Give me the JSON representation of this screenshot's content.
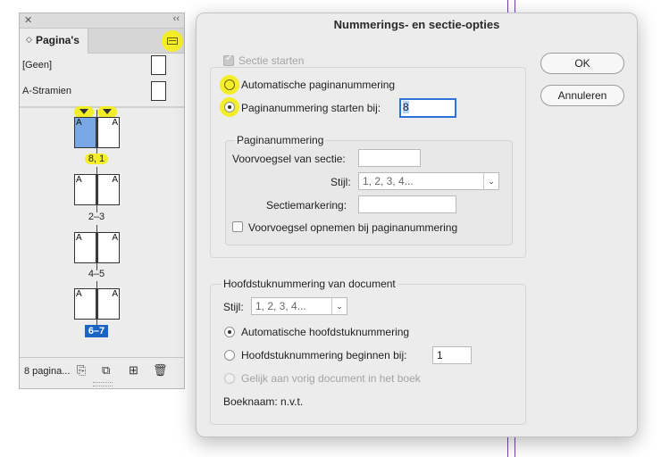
{
  "pages_panel": {
    "close_icon": "close-icon",
    "collapse_icon": "double-chevron-icon",
    "tab_label": "Pagina's",
    "masters": [
      "[Geen]",
      "A-Stramien"
    ],
    "spreads": [
      {
        "label": "8, 1",
        "left_letter": "A",
        "right_letter": "A"
      },
      {
        "label": "2–3",
        "left_letter": "A",
        "right_letter": "A"
      },
      {
        "label": "4–5",
        "left_letter": "A",
        "right_letter": "A"
      },
      {
        "label": "6–7",
        "left_letter": "A",
        "right_letter": "A"
      }
    ],
    "footer_count": "8 pagina...",
    "highlight_color": "#f4ee2a",
    "selection_color": "#1a64c6"
  },
  "dialog": {
    "title": "Nummerings- en sectie-opties",
    "section_start_label": "Sectie starten",
    "auto_numbering_label": "Automatische paginanummering",
    "start_at_label": "Paginanummering starten bij:",
    "start_at_value": "8",
    "page_numbering_group": {
      "title": "Paginanummering",
      "prefix_label": "Voorvoegsel van sectie:",
      "prefix_value": "",
      "style_label": "Stijl:",
      "style_value": "1, 2, 3, 4...",
      "marker_label": "Sectiemarkering:",
      "marker_value": "",
      "include_prefix_label": "Voorvoegsel opnemen bij paginanummering"
    },
    "chapter_group": {
      "title": "Hoofdstuknummering van document",
      "style_label": "Stijl:",
      "style_value": "1, 2, 3, 4...",
      "auto_label": "Automatische hoofdstuknummering",
      "start_label": "Hoofdstuknummering beginnen bij:",
      "start_value": "1",
      "same_as_prev_label": "Gelijk aan vorig document in het boek",
      "book_name": "Boeknaam: n.v.t."
    },
    "ok_label": "OK",
    "cancel_label": "Annuleren"
  }
}
